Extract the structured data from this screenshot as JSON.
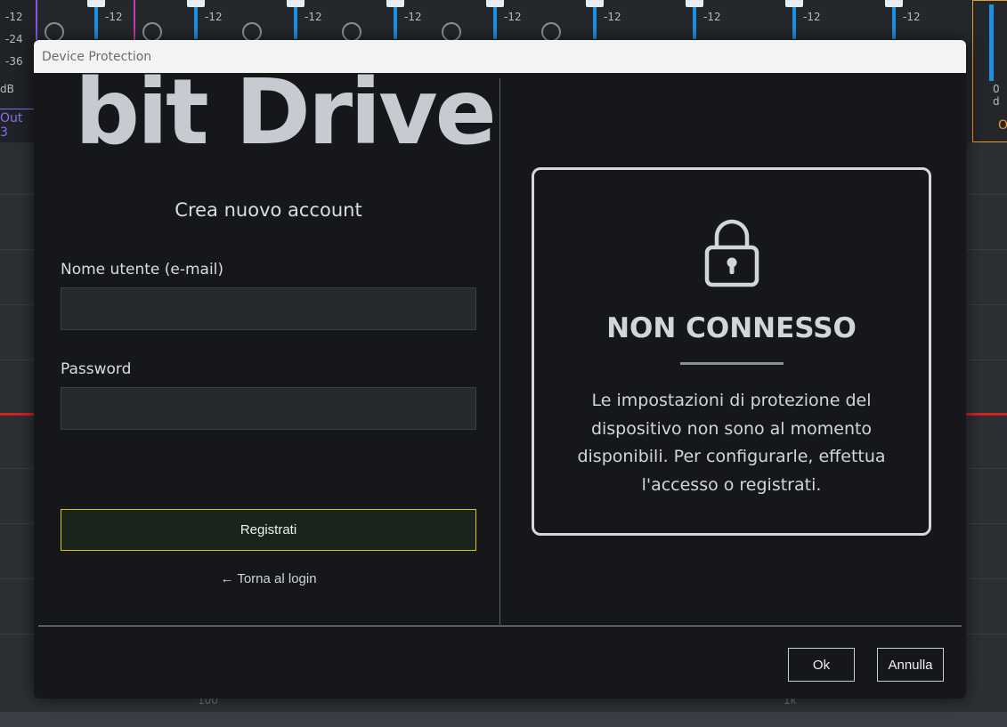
{
  "background": {
    "db_labels": [
      "-12",
      "-24",
      "-36",
      "dB"
    ],
    "strip_db_label": "-12",
    "strip_db_label_2": "-24",
    "out_label": "Out 3",
    "right_db": "0 d",
    "right_label": "O",
    "axis_label_left": "100",
    "axis_label_right": "1k"
  },
  "dialog": {
    "title": "Device Protection",
    "logo_text": "bit Drive",
    "form": {
      "heading": "Crea nuovo account",
      "username_label": "Nome utente (e-mail)",
      "username_value": "",
      "password_label": "Password",
      "password_value": "",
      "register_button": "Registrati",
      "back_link": "← Torna al login"
    },
    "status": {
      "icon": "lock-icon",
      "title": "NON CONNESSO",
      "message": "Le impostazioni di protezione del dispositivo non sono al momento disponibili. Per configurarle, effettua l'accesso o registrati."
    },
    "buttons": {
      "ok": "Ok",
      "cancel": "Annulla"
    },
    "colors": {
      "register_border": "#d9c419",
      "accent_blue": "#1f8fe0",
      "background": "#15171a"
    }
  }
}
